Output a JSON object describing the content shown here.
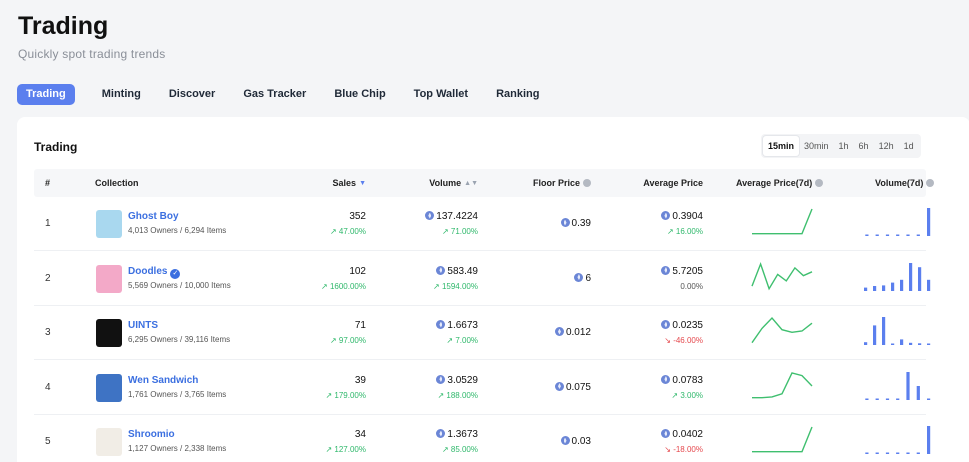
{
  "page": {
    "title": "Trading",
    "subtitle": "Quickly spot trading trends"
  },
  "nav": {
    "tabs": [
      "Trading",
      "Minting",
      "Discover",
      "Gas Tracker",
      "Blue Chip",
      "Top Wallet",
      "Ranking"
    ],
    "active": 0
  },
  "card": {
    "title": "Trading",
    "timeframes": [
      "15min",
      "30min",
      "1h",
      "6h",
      "12h",
      "1d"
    ],
    "active_timeframe": 0
  },
  "columns": {
    "index": "#",
    "collection": "Collection",
    "sales": "Sales",
    "volume": "Volume",
    "floor": "Floor Price",
    "avg": "Average Price",
    "avg7d": "Average Price(7d)",
    "vol7d": "Volume(7d)"
  },
  "colors": {
    "accent": "#5b7fee",
    "link": "#3b6fe0",
    "up": "#2fb86b",
    "down": "#e5484d",
    "sparkline": "#3fbf6f",
    "volume_bar": "#5b7fee"
  },
  "rows": [
    {
      "rank": "1",
      "name": "Ghost Boy",
      "verified": false,
      "info": "4,013 Owners / 6,294 Items",
      "sales": "352",
      "sales_change": "↗ 47.00%",
      "sales_dir": "up",
      "volume": "137.4224",
      "volume_change": "↗ 71.00%",
      "volume_dir": "up",
      "floor": "0.39",
      "avg": "0.3904",
      "avg_change": "↗ 16.00%",
      "avg_dir": "up",
      "avatar_bg": "#a9d8ef",
      "spark": [
        0.05,
        0.05,
        0.05,
        0.05,
        0.05,
        0.05,
        1.0
      ],
      "volume_bars": [
        0,
        0,
        0,
        0,
        0,
        0,
        1.0
      ]
    },
    {
      "rank": "2",
      "name": "Doodles",
      "verified": true,
      "info": "5,569 Owners / 10,000 Items",
      "sales": "102",
      "sales_change": "↗ 1600.00%",
      "sales_dir": "up",
      "volume": "583.49",
      "volume_change": "↗ 1594.00%",
      "volume_dir": "up",
      "floor": "6",
      "avg": "5.7205",
      "avg_change": "0.00%",
      "avg_dir": "flat",
      "avatar_bg": "#f3a9c8",
      "spark": [
        0.15,
        1.0,
        0.05,
        0.6,
        0.35,
        0.85,
        0.55,
        0.7
      ],
      "volume_bars": [
        0.12,
        0.18,
        0.2,
        0.3,
        0.4,
        1.0,
        0.85,
        0.4
      ]
    },
    {
      "rank": "3",
      "name": "UINTS",
      "verified": false,
      "info": "6,295 Owners / 39,116 Items",
      "sales": "71",
      "sales_change": "↗ 97.00%",
      "sales_dir": "up",
      "volume": "1.6673",
      "volume_change": "↗ 7.00%",
      "volume_dir": "up",
      "floor": "0.012",
      "avg": "0.0235",
      "avg_change": "↘ -46.00%",
      "avg_dir": "down",
      "avatar_bg": "#111111",
      "spark": [
        0.05,
        0.6,
        1.0,
        0.55,
        0.45,
        0.5,
        0.8
      ],
      "volume_bars": [
        0.1,
        0.7,
        1.0,
        0.05,
        0.2,
        0.08,
        0.06,
        0.05
      ]
    },
    {
      "rank": "4",
      "name": "Wen Sandwich",
      "verified": false,
      "info": "1,761 Owners / 3,765 Items",
      "sales": "39",
      "sales_change": "↗ 179.00%",
      "sales_dir": "up",
      "volume": "3.0529",
      "volume_change": "↗ 188.00%",
      "volume_dir": "up",
      "floor": "0.075",
      "avg": "0.0783",
      "avg_change": "↗ 3.00%",
      "avg_dir": "up",
      "avatar_bg": "#3e73c4",
      "spark": [
        0.05,
        0.05,
        0.08,
        0.2,
        1.0,
        0.9,
        0.5
      ],
      "volume_bars": [
        0,
        0,
        0,
        0,
        1.0,
        0.5,
        0.05
      ]
    },
    {
      "rank": "5",
      "name": "Shroomio",
      "verified": false,
      "info": "1,127 Owners / 2,338 Items",
      "sales": "34",
      "sales_change": "↗ 127.00%",
      "sales_dir": "up",
      "volume": "1.3673",
      "volume_change": "↗ 85.00%",
      "volume_dir": "up",
      "floor": "0.03",
      "avg": "0.0402",
      "avg_change": "↘ -18.00%",
      "avg_dir": "down",
      "avatar_bg": "#f1ede6",
      "spark": [
        0.05,
        0.05,
        0.05,
        0.05,
        0.05,
        0.05,
        1.0
      ],
      "volume_bars": [
        0,
        0,
        0,
        0,
        0,
        0,
        1.0
      ]
    }
  ]
}
